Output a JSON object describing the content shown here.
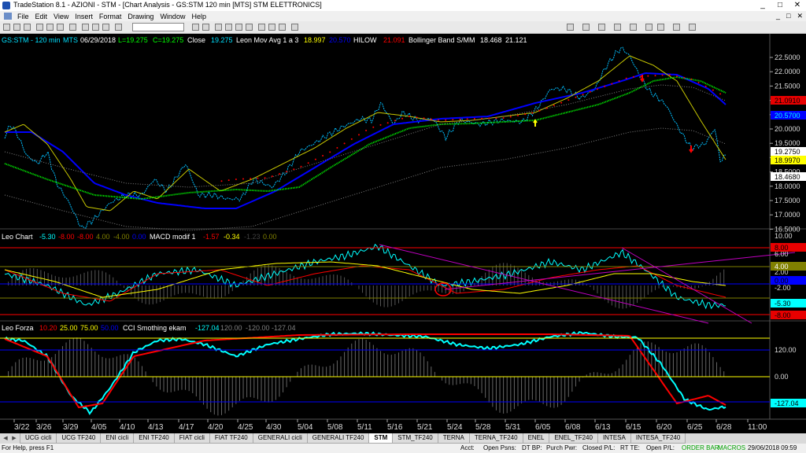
{
  "window": {
    "title": "TradeStation 8.1 - AZIONI - STM - [Chart Analysis - GS:STM  120 min  [MTS] STM ELETTRONICS]",
    "controls": [
      "_",
      "□",
      "✕"
    ]
  },
  "menu": {
    "items": [
      "File",
      "Edit",
      "View",
      "Insert",
      "Format",
      "Drawing",
      "Window",
      "Help"
    ],
    "doc_controls": [
      "_",
      "□",
      "✕"
    ]
  },
  "chart": {
    "header": {
      "symbol": "GS:STM - 120 min",
      "exchange": "MTS",
      "date": "06/29/2018",
      "low": "L=19.275",
      "close": "C=19.275",
      "close_label": "Close",
      "close_val": "19.275",
      "mov_name": "Leon Mov Avg 1 a 3",
      "mov_v1": "18.997",
      "mov_v2": "20.570",
      "hilow": "HILOW",
      "hilow_v": "21.091",
      "bb_name": "Bollinger Band S/MM",
      "bb_v1": "18.468",
      "bb_v2": "21.121"
    },
    "price_axis": [
      "22.5000",
      "22.0000",
      "21.5000",
      "21.0000",
      "20.5000",
      "20.0000",
      "19.5000",
      "19.0000",
      "18.5000",
      "18.0000",
      "17.5000",
      "17.0000",
      "16.5000"
    ],
    "price_tags": [
      {
        "text": "21.0910",
        "bg": "#e80000",
        "fg": "#000000"
      },
      {
        "text": "20.5700",
        "bg": "#0000ff",
        "fg": "#00ffff"
      },
      {
        "text": "19.2750",
        "bg": "#ffffff",
        "fg": "#000000"
      },
      {
        "text": "18.9970",
        "bg": "#ffff00",
        "fg": "#000000"
      },
      {
        "text": "18.4680",
        "bg": "#ffffff",
        "fg": "#000000"
      }
    ],
    "macd": {
      "header": {
        "name": "Leo Chart",
        "v1": "-5.30",
        "v2": "-8.00",
        "v3": "-8.00",
        "v4": "4.00",
        "v5": "-4.00",
        "v6": "0.00",
        "ind": "MACD modif 1",
        "v7": "-1.57",
        "v8": "-0.34",
        "v9": "-1.23",
        "v10": "0.00"
      },
      "axis": [
        "10.00",
        "6.00",
        "2.00",
        "-2.00",
        "-6.00"
      ],
      "tags": [
        {
          "text": "8.00",
          "bg": "#e80000",
          "fg": "#000000"
        },
        {
          "text": "4.00",
          "bg": "#808000",
          "fg": "#ffffff"
        },
        {
          "text": "0.00",
          "bg": "#0000ff",
          "fg": "#000000"
        },
        {
          "text": "-5.30",
          "bg": "#00ffff",
          "fg": "#000000"
        },
        {
          "text": "-8.00",
          "bg": "#e80000",
          "fg": "#000000"
        }
      ]
    },
    "cci": {
      "header": {
        "name": "Leo Forza",
        "v1": "10.20",
        "v2": "25.00",
        "v3": "75.00",
        "v4": "50.00",
        "ind": "CCI Smothing ekam",
        "v5": "-127.04",
        "v6": "120.00",
        "v7": "-120.00",
        "v8": "-127.04"
      },
      "axis": [
        "120.00",
        "0.00",
        "-120.00"
      ],
      "tags": [
        {
          "text": "-127.04",
          "bg": "#00ffff",
          "fg": "#000000"
        }
      ]
    },
    "dates": [
      "3/22",
      "3/26",
      "3/29",
      "4/05",
      "4/10",
      "4/13",
      "4/17",
      "4/20",
      "4/25",
      "4/30",
      "5/04",
      "5/08",
      "5/11",
      "5/16",
      "5/21",
      "5/24",
      "5/28",
      "5/31",
      "6/05",
      "6/08",
      "6/13",
      "6/15",
      "6/20",
      "6/25",
      "6/28",
      "11:00"
    ],
    "colors": {
      "background": "#000000",
      "price": "#00bfff",
      "ma_fast": "#c8c800",
      "ma_slow": "#0000ff",
      "ma_green": "#00ff00",
      "ma_red": "#ff0000",
      "bb": "#808080",
      "trendline": "#c000c0"
    }
  },
  "tabs": {
    "items": [
      "UCG cicli",
      "UCG TF240",
      "ENI cicli",
      "ENI TF240",
      "FIAT cicli",
      "FIAT TF240",
      "GENERALI cicli",
      "GENERALI TF240",
      "STM",
      "STM_TF240",
      "TERNA",
      "TERNA_TF240",
      "ENEL",
      "ENEL_TF240",
      "INTESA",
      "INTESA_TF240"
    ],
    "active": "STM"
  },
  "status": {
    "help": "For Help, press F1",
    "acct": "Acct:",
    "open_psns": "Open Psns:",
    "dt_bp": "DT BP:",
    "purch_pwr": "Purch Pwr:",
    "closed_pl": "Closed P/L:",
    "rt_te": "RT TE:",
    "open_pl": "Open P/L:",
    "order_bar": "ORDER BAR",
    "macros": "MACROS",
    "datetime": "29/06/2018 09:59"
  }
}
